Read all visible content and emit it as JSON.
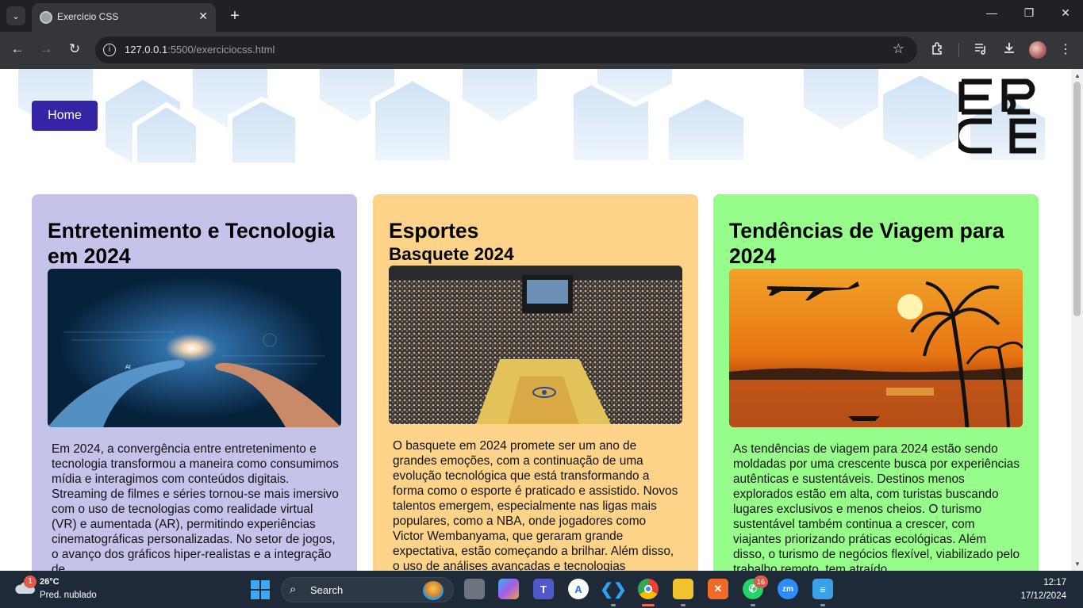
{
  "browser": {
    "tab_title": "Exercício CSS",
    "url_host": "127.0.0.1",
    "url_rest": ":5500/exerciciocss.html"
  },
  "page": {
    "nav": {
      "home_label": "Home"
    },
    "cards": [
      {
        "title": "Entretenimento e Tecnologia em 2024",
        "subtitle": "",
        "background": "#c5c3ea",
        "image": "ai-hand-touch-image",
        "text": "Em 2024, a convergência entre entretenimento e tecnologia transformou a maneira como consumimos mídia e interagimos com conteúdos digitais. Streaming de filmes e séries tornou-se mais imersivo com o uso de tecnologias como realidade virtual (VR) e aumentada (AR), permitindo experiências cinematográficas personalizadas. No setor de jogos, o avanço dos gráficos hiper-realistas e a integração de"
      },
      {
        "title": "Esportes",
        "subtitle": "Basquete 2024",
        "background": "#fdd38a",
        "image": "basketball-arena-image",
        "text": "O basquete em 2024 promete ser um ano de grandes emoções, com a continuação de uma evolução tecnológica que está transformando a forma como o esporte é praticado e assistido. Novos talentos emergem, especialmente nas ligas mais populares, como a NBA, onde jogadores como Victor Wembanyama, que geraram grande expectativa, estão começando a brilhar. Além disso, o uso de análises avançadas e tecnologias"
      },
      {
        "title": "Tendências de Viagem para 2024",
        "subtitle": "",
        "background": "#97fd8a",
        "image": "sunset-airplane-palms-image",
        "text": "As tendências de viagem para 2024 estão sendo moldadas por uma crescente busca por experiências autênticas e sustentáveis. Destinos menos explorados estão em alta, com turistas buscando lugares exclusivos e menos cheios. O turismo sustentável também continua a crescer, com viajantes priorizando práticas ecológicas. Além disso, o turismo de negócios flexível, viabilizado pelo trabalho remoto, tem atraído"
      }
    ],
    "accent": "#3325a3"
  },
  "taskbar": {
    "weather_temp": "26°C",
    "weather_desc": "Pred. nublado",
    "weather_badge": "1",
    "search_label": "Search",
    "whatsapp_badge": "16",
    "zoom_label": "zm",
    "time": "12:17",
    "date": "17/12/2024"
  }
}
